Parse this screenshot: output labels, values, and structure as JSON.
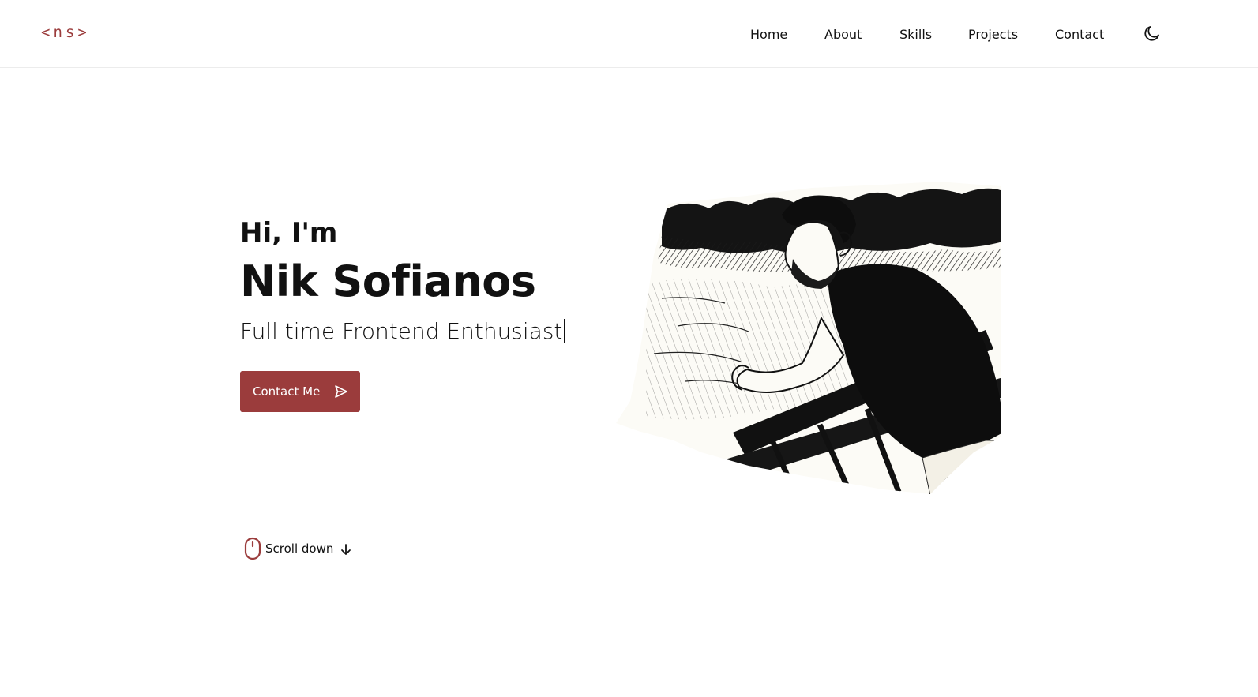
{
  "header": {
    "logo": "<ns>",
    "nav": [
      {
        "label": "Home"
      },
      {
        "label": "About"
      },
      {
        "label": "Skills"
      },
      {
        "label": "Projects"
      },
      {
        "label": "Contact"
      }
    ],
    "theme_toggle_icon": "moon-icon"
  },
  "hero": {
    "greeting": "Hi, I'm",
    "name": "Nik Sofianos",
    "tagline": "Full time Frontend Enthusiast",
    "cta_label": "Contact Me",
    "cta_icon": "send-icon",
    "scroll_label": "Scroll down",
    "scroll_icons": [
      "mouse-icon",
      "arrow-down-icon"
    ],
    "portrait_icon": "profile-image"
  },
  "colors": {
    "accent": "#9b3c3c",
    "text": "#111111",
    "background": "#ffffff"
  }
}
